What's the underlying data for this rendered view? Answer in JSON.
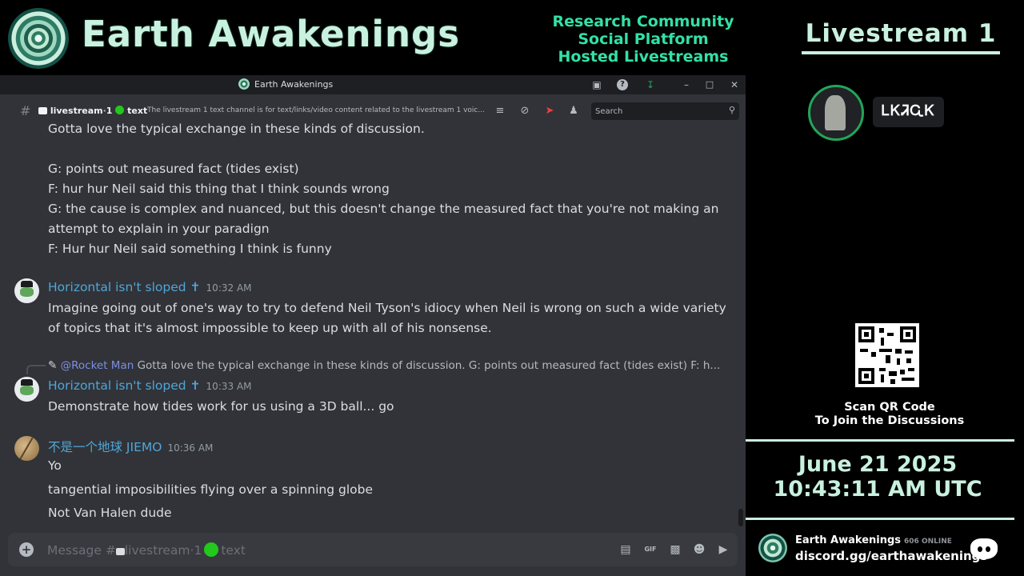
{
  "banner": {
    "brand": "Earth Awakenings",
    "taglines": [
      "Research Community",
      "Social Platform",
      "Hosted Livestreams"
    ]
  },
  "window": {
    "title": "Earth Awakenings"
  },
  "channel": {
    "name": "livestream",
    "name_suffix": "1",
    "name_tail": "text",
    "topic": "The livestream 1 text channel is for text/links/video content related to the livestream 1 voic...",
    "search_placeholder": "Search"
  },
  "messages": {
    "block1": [
      "Gotta love the typical exchange in these kinds of discussion.",
      "G: points out measured fact (tides exist)",
      "F: hur hur Neil said this thing that I think sounds wrong",
      "G: the cause is complex and nuanced, but this doesn't change the measured fact that you're not making an",
      "attempt to explain in your paradign",
      "F: Hur hur Neil said something I think is funny"
    ],
    "msg2": {
      "author": "Horizontal isn't sloped ✝",
      "time": "10:32 AM",
      "lines": [
        "Imagine going out of one's way to try to defend Neil Tyson's idiocy when Neil is wrong on such a wide variety",
        "of topics that it's almost impossible to keep up with all of his nonsense."
      ]
    },
    "reply": {
      "mention": "@Rocket Man",
      "text": "Gotta love the typical exchange in these kinds of discussion.  G: points out measured fact (tides exist) F: h..."
    },
    "msg3": {
      "author": "Horizontal isn't sloped ✝",
      "time": "10:33 AM",
      "lines": [
        "Demonstrate how tides work for us using a 3D ball... go"
      ]
    },
    "msg4": {
      "author": "不是一个地球 JIEMO",
      "time": "10:36 AM",
      "lines": [
        "Yo",
        "tangential  imposibilities flying over a spinning globe",
        "Not Van Halen dude"
      ]
    }
  },
  "composer": {
    "prefix": "Message #",
    "channel": "livestream",
    "suffix": "1",
    "tail": "text"
  },
  "panel": {
    "title": "Livestream 1",
    "host_name": "ᏞᏦᏘᏩᏦ",
    "qr_caption": [
      "Scan QR Code",
      "To Join the Discussions"
    ],
    "date": "June 21 2025",
    "time": "10:43:11 AM UTC",
    "server_name": "Earth Awakenings",
    "online": "606 ONLINE",
    "invite": "discord.gg/earthawakenings"
  },
  "icons": {
    "titlebar": [
      "screen-share-icon",
      "help-icon",
      "download-icon",
      "minimize-icon",
      "maximize-icon",
      "close-icon"
    ],
    "header": [
      "threads-icon",
      "notifications-muted-icon",
      "pin-icon",
      "members-icon"
    ],
    "composer": [
      "gift-icon",
      "gif-icon",
      "sticker-icon",
      "emoji-icon",
      "apps-icon"
    ]
  },
  "colors": {
    "accent_green": "#33e0a6",
    "brand_mint": "#c9f1df",
    "author_blue": "#4fa6d8",
    "discord_bg": "#313338"
  }
}
